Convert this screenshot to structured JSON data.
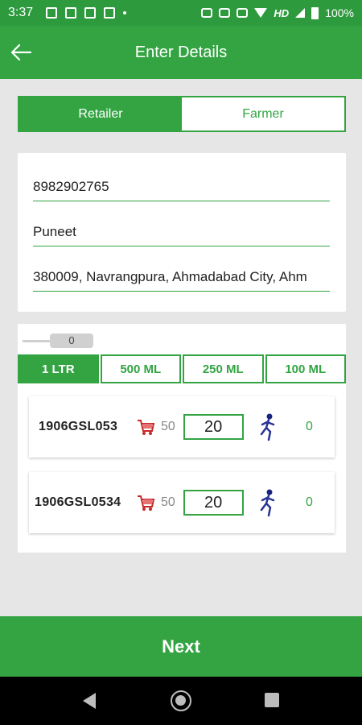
{
  "status_bar": {
    "time": "3:37",
    "network": "HD",
    "battery": "100%"
  },
  "app_bar": {
    "title": "Enter Details"
  },
  "segment": {
    "options": [
      "Retailer",
      "Farmer"
    ],
    "selected": "Retailer"
  },
  "details": {
    "phone": "8982902765",
    "name": "Puneet",
    "address": "380009, Navrangpura, Ahmadabad City, Ahm"
  },
  "slider": {
    "value": "0"
  },
  "size_tabs": [
    "1 LTR",
    "500 ML",
    "250 ML",
    "100 ML"
  ],
  "selected_tab": "1 LTR",
  "items": [
    {
      "code": "1906GSL053",
      "stock": "50",
      "qty": "20",
      "count": "0"
    },
    {
      "code": "1906GSL0534",
      "stock": "50",
      "qty": "20",
      "count": "0"
    }
  ],
  "footer": {
    "next_label": "Next"
  },
  "colors": {
    "primary": "#34a443",
    "status_bar": "#2e9a3e",
    "background": "#e6e6e6"
  },
  "icons": [
    "back-arrow-icon",
    "cart-icon",
    "runner-icon",
    "nav-back-icon",
    "nav-home-icon",
    "nav-recent-icon"
  ]
}
